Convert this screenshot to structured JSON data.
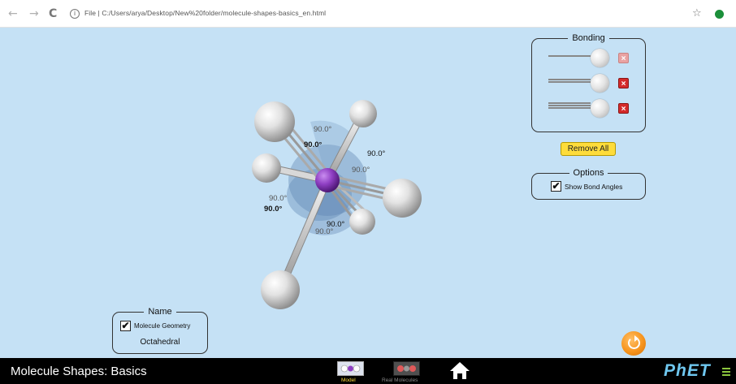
{
  "browser": {
    "back_glyph": "←",
    "forward_glyph": "→",
    "reload_glyph": "C",
    "info_glyph": "i",
    "url": "File | C:/Users/arya/Desktop/New%20folder/molecule-shapes-basics_en.html",
    "star_glyph": "☆"
  },
  "bonding_panel": {
    "title": "Bonding",
    "rows": [
      {
        "bond": "single",
        "remove_glyph": "×",
        "enabled": false
      },
      {
        "bond": "double",
        "remove_glyph": "×",
        "enabled": true
      },
      {
        "bond": "triple",
        "remove_glyph": "×",
        "enabled": true
      }
    ],
    "remove_all_label": "Remove All"
  },
  "options_panel": {
    "title": "Options",
    "show_bond_angles_label": "Show Bond Angles",
    "show_bond_angles_checked": true,
    "check_glyph": "✔"
  },
  "name_panel": {
    "title": "Name",
    "molecule_geometry_label": "Molecule Geometry",
    "molecule_geometry_checked": true,
    "check_glyph": "✔",
    "geometry_name": "Octahedral"
  },
  "molecule": {
    "angle_labels": [
      "90.0°",
      "90.0°",
      "90.0°",
      "90.0°",
      "90.0°",
      "90.0°",
      "90.0°",
      "90.0°"
    ],
    "central_atom_color": "#8f3fc3",
    "outer_atom_color": "#e8e8e8"
  },
  "navbar": {
    "sim_title": "Molecule Shapes: Basics",
    "screens": [
      {
        "label": "Model",
        "selected": true
      },
      {
        "label": "Real Molecules",
        "selected": false
      }
    ],
    "logo_text": "PhET"
  },
  "colors": {
    "sim_background": "#c5e1f5",
    "remove_all": "#fedc3b",
    "reset": "#f7941d",
    "remove_bond": "#d42a2a"
  }
}
